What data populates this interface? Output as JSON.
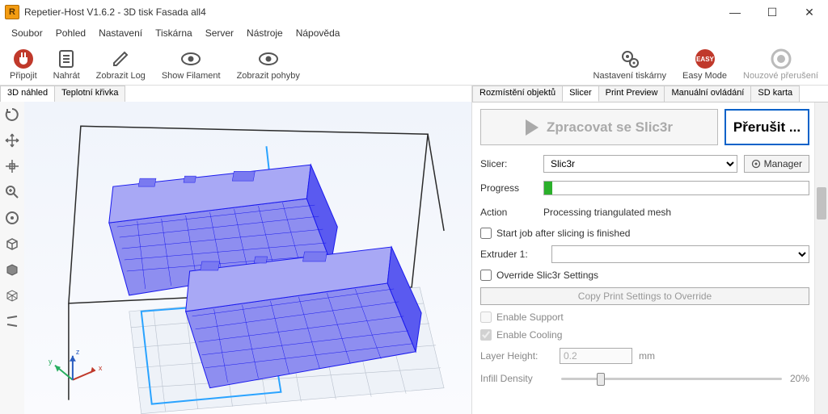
{
  "window": {
    "app_icon_letter": "R",
    "title": "Repetier-Host V1.6.2 - 3D tisk Fasada all4",
    "minimize": "—",
    "maximize": "☐",
    "close": "✕"
  },
  "menu": [
    "Soubor",
    "Pohled",
    "Nastavení",
    "Tiskárna",
    "Server",
    "Nástroje",
    "Nápověda"
  ],
  "toolbar": {
    "connect": "Připojit",
    "upload": "Nahrát",
    "showlog": "Zobrazit Log",
    "showfilament": "Show Filament",
    "showmoves": "Zobrazit pohyby",
    "printer_settings": "Nastavení tiskárny",
    "easy_mode": "Easy Mode",
    "emergency": "Nouzové přerušení"
  },
  "left_tabs": {
    "preview3d": "3D náhled",
    "tempcurve": "Teplotní křivka"
  },
  "right_tabs": {
    "placement": "Rozmístění objektů",
    "slicer": "Slicer",
    "print_preview": "Print Preview",
    "manual": "Manuální ovládání",
    "sd": "SD karta"
  },
  "slicer_panel": {
    "process_btn": "Zpracovat se Slic3r",
    "cancel_btn": "Přerušit ...",
    "slicer_label": "Slicer:",
    "slicer_value": "Slic3r",
    "manager_btn": "Manager",
    "progress_label": "Progress",
    "action_label": "Action",
    "action_value": "Processing triangulated mesh",
    "startjob_label": "Start job after slicing is finished",
    "extruder_label": "Extruder 1:",
    "extruder_value": "",
    "override_label": "Override Slic3r Settings",
    "copy_btn": "Copy Print Settings to Override",
    "enable_support": "Enable Support",
    "enable_cooling": "Enable Cooling",
    "layer_height_label": "Layer Height:",
    "layer_height_value": "0.2",
    "layer_height_unit": "mm",
    "infill_label": "Infill Density",
    "infill_value": "20%"
  }
}
